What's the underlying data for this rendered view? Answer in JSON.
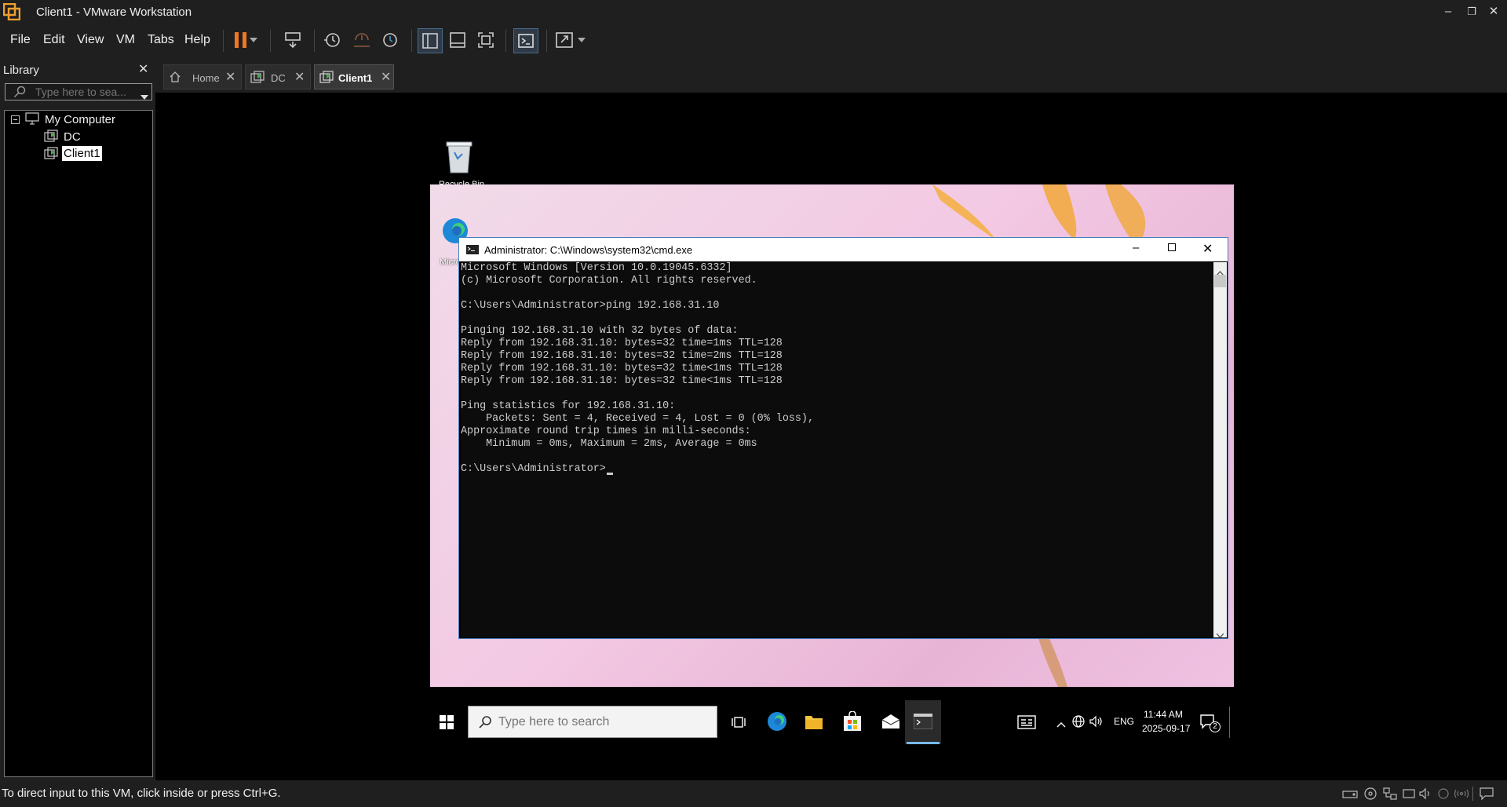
{
  "app": {
    "window_title": "Client1 - VMware Workstation",
    "brand_color": "#f0a030"
  },
  "menu": [
    "File",
    "Edit",
    "View",
    "VM",
    "Tabs",
    "Help"
  ],
  "library": {
    "title": "Library",
    "search_placeholder": "Type here to sea...",
    "tree": {
      "root": "My Computer",
      "items": [
        "DC",
        "Client1"
      ],
      "selected": "Client1"
    }
  },
  "tabs": [
    {
      "label": "Home",
      "icon": "home-icon"
    },
    {
      "label": "DC",
      "icon": "vm-icon"
    },
    {
      "label": "Client1",
      "icon": "vm-icon",
      "active": true
    }
  ],
  "desktop": {
    "icons": [
      "Recycle Bin",
      "Microsoft Edge"
    ]
  },
  "cmd": {
    "title": "Administrator: C:\\Windows\\system32\\cmd.exe",
    "output": "Microsoft Windows [Version 10.0.19045.6332]\n(c) Microsoft Corporation. All rights reserved.\n\nC:\\Users\\Administrator>ping 192.168.31.10\n\nPinging 192.168.31.10 with 32 bytes of data:\nReply from 192.168.31.10: bytes=32 time=1ms TTL=128\nReply from 192.168.31.10: bytes=32 time=2ms TTL=128\nReply from 192.168.31.10: bytes=32 time<1ms TTL=128\nReply from 192.168.31.10: bytes=32 time<1ms TTL=128\n\nPing statistics for 192.168.31.10:\n    Packets: Sent = 4, Received = 4, Lost = 0 (0% loss),\nApproximate round trip times in milli-seconds:\n    Minimum = 0ms, Maximum = 2ms, Average = 0ms\n\nC:\\Users\\Administrator>"
  },
  "taskbar": {
    "search_placeholder": "Type here to search",
    "language": "ENG",
    "time": "11:44 AM",
    "date": "2025-09-17",
    "notification_count": "2"
  },
  "status": {
    "message": "To direct input to this VM, click inside or press Ctrl+G."
  }
}
